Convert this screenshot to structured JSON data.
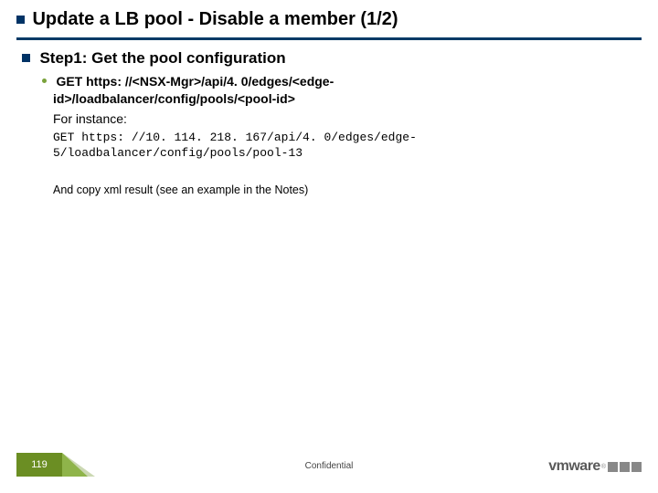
{
  "title": "Update a LB pool - Disable a member (1/2)",
  "step1": {
    "heading": "Step1: Get the pool configuration",
    "api_line1": "GET https: //<NSX-Mgr>/api/4. 0/edges/<edge-",
    "api_line2": "id>/loadbalancer/config/pools/<pool-id>",
    "for_instance": "For instance:",
    "code": "GET https: //10. 114. 218. 167/api/4. 0/edges/edge-\n5/loadbalancer/config/pools/pool-13",
    "note": "And copy xml result (see an example in the Notes)"
  },
  "footer": {
    "page": "119",
    "confidential": "Confidential",
    "brand": "vmware"
  }
}
